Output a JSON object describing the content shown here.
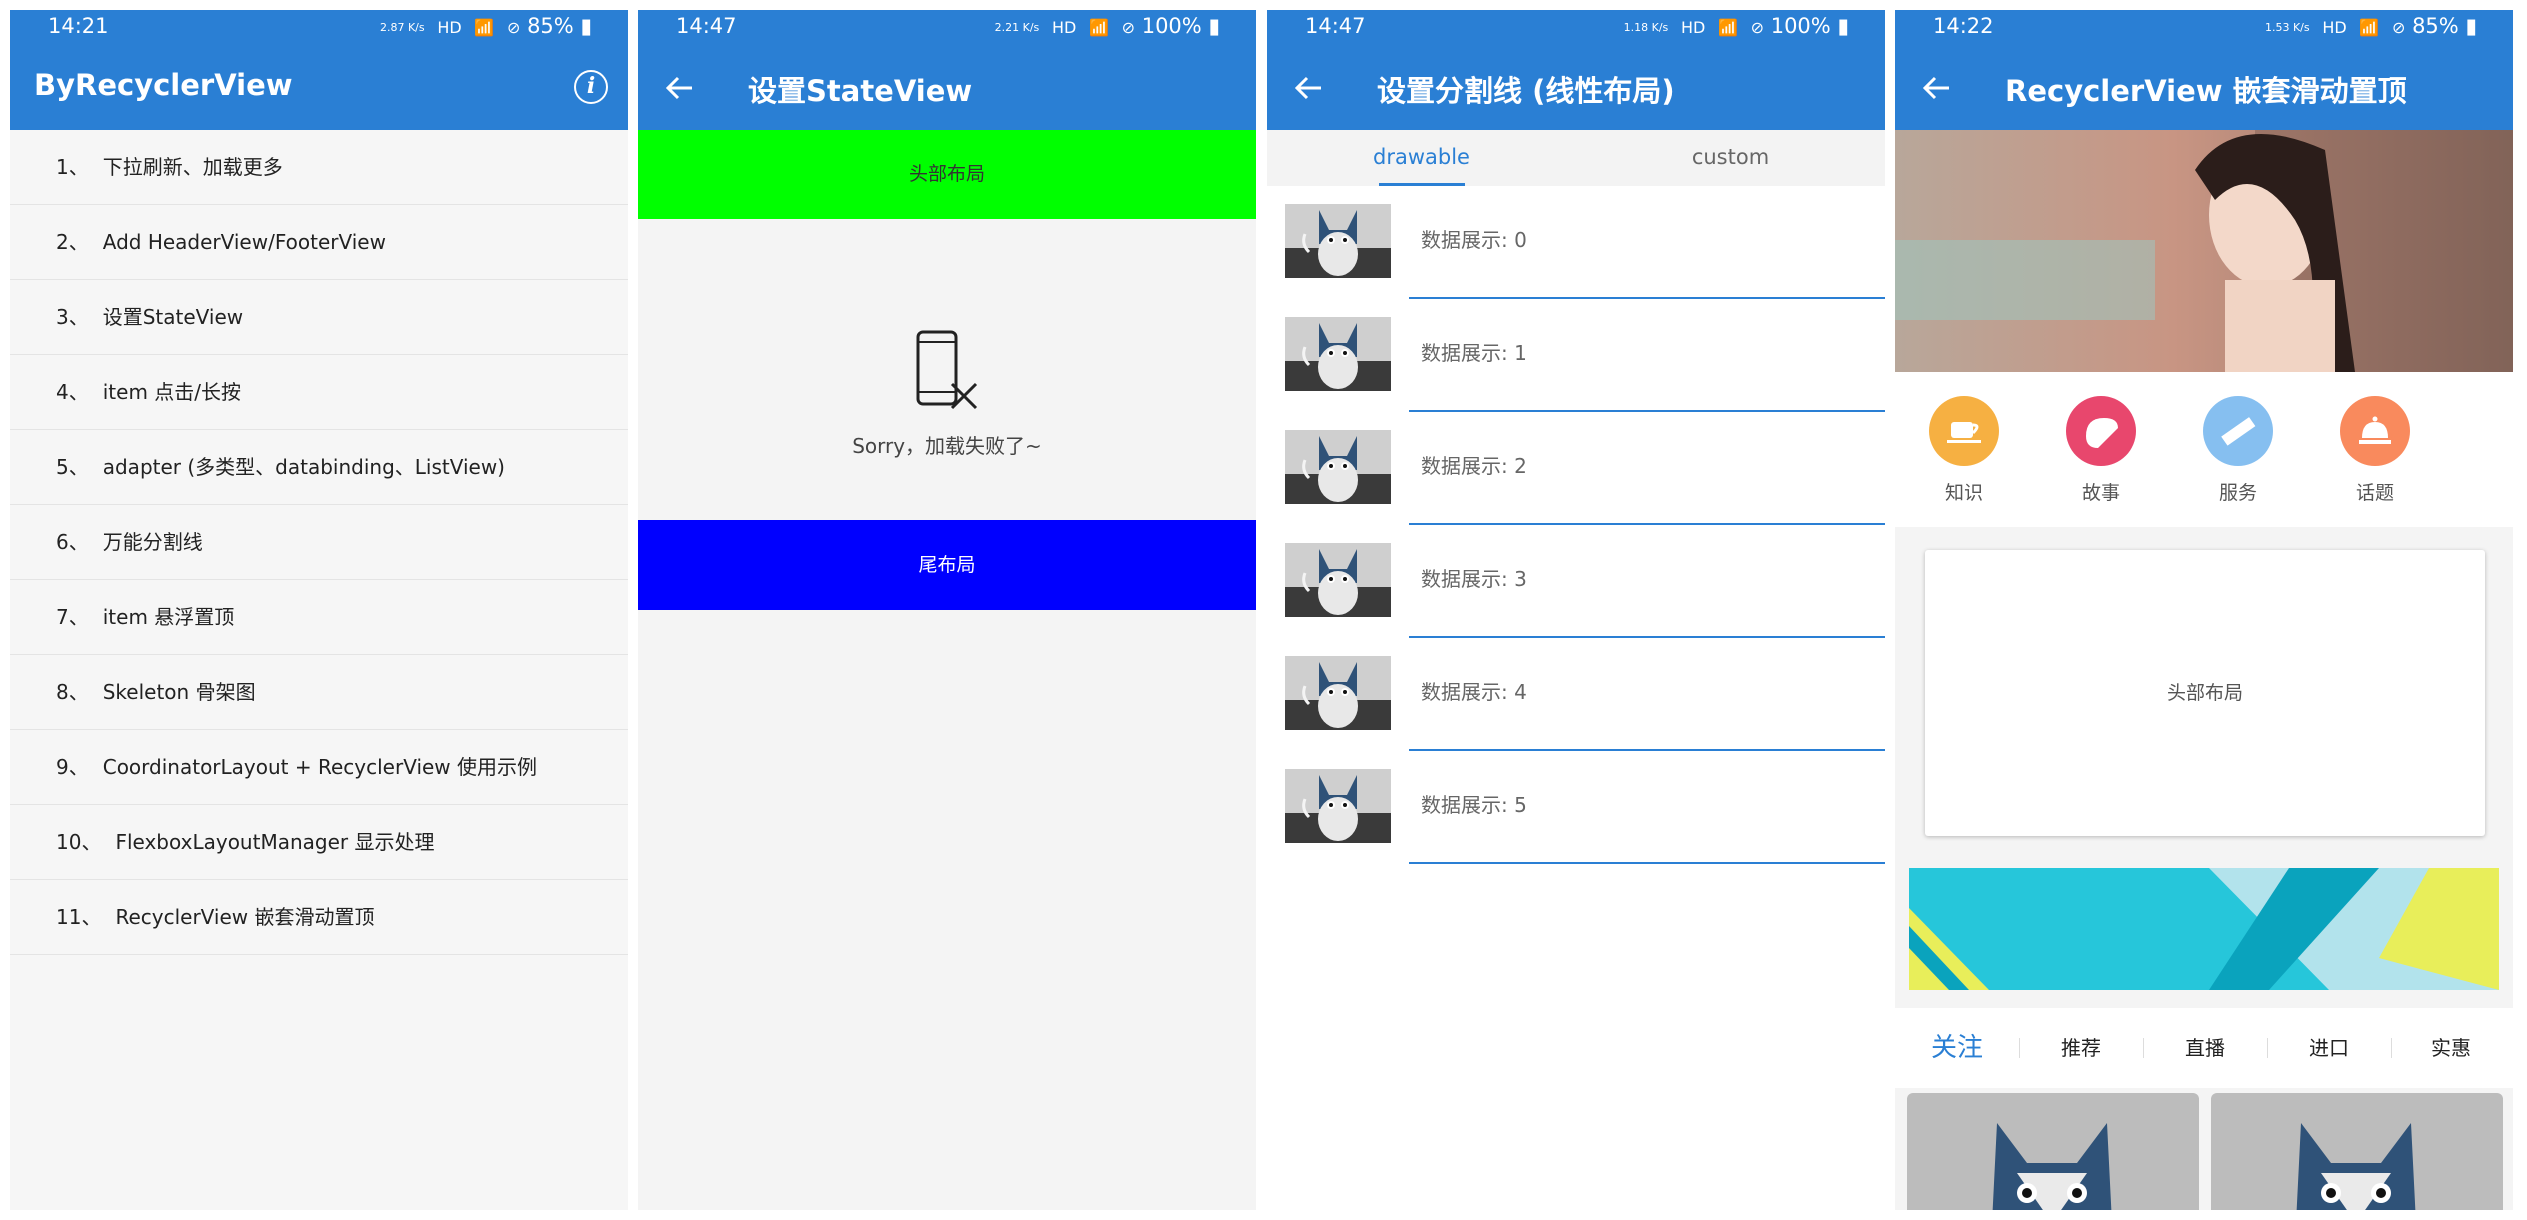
{
  "colors": {
    "primary": "#2a7fd4",
    "header_green": "#00ff00",
    "footer_blue": "#0000ff"
  },
  "panel1": {
    "status": {
      "time": "14:21",
      "speed": "2.87 K/s",
      "hd": "HD",
      "battery": "85%"
    },
    "title": "ByRecyclerView",
    "info_icon": "i",
    "items": [
      {
        "num": "1、",
        "label": "下拉刷新、加载更多"
      },
      {
        "num": "2、",
        "label": "Add HeaderView/FooterView"
      },
      {
        "num": "3、",
        "label": "设置StateView"
      },
      {
        "num": "4、",
        "label": "item 点击/长按"
      },
      {
        "num": "5、",
        "label": "adapter (多类型、databinding、ListView)"
      },
      {
        "num": "6、",
        "label": "万能分割线"
      },
      {
        "num": "7、",
        "label": "item 悬浮置顶"
      },
      {
        "num": "8、",
        "label": "Skeleton 骨架图"
      },
      {
        "num": "9、",
        "label": "CoordinatorLayout + RecyclerView 使用示例"
      },
      {
        "num": "10、",
        "label": "FlexboxLayoutManager 显示处理"
      },
      {
        "num": "11、",
        "label": "RecyclerView 嵌套滑动置顶"
      }
    ]
  },
  "panel2": {
    "status": {
      "time": "14:47",
      "speed": "2.21 K/s",
      "hd": "HD",
      "battery": "100%"
    },
    "title": "设置StateView",
    "header_label": "头部布局",
    "error_text": "Sorry，加载失败了~",
    "footer_label": "尾布局"
  },
  "panel3": {
    "status": {
      "time": "14:47",
      "speed": "1.18 K/s",
      "hd": "HD",
      "battery": "100%"
    },
    "title": "设置分割线 (线性布局)",
    "tabs": [
      "drawable",
      "custom"
    ],
    "rows": [
      "数据展示: 0",
      "数据展示: 1",
      "数据展示: 2",
      "数据展示: 3",
      "数据展示: 4",
      "数据展示: 5"
    ]
  },
  "panel4": {
    "status": {
      "time": "14:22",
      "speed": "1.53 K/s",
      "hd": "HD",
      "battery": "85%"
    },
    "title": "RecyclerView 嵌套滑动置顶",
    "categories": [
      {
        "label": "知识",
        "color": "#f6b042",
        "icon": "cup-icon"
      },
      {
        "label": "故事",
        "color": "#e8476d",
        "icon": "bread-icon"
      },
      {
        "label": "服务",
        "color": "#86bff0",
        "icon": "ruler-icon"
      },
      {
        "label": "话题",
        "color": "#f98a5d",
        "icon": "bell-icon"
      }
    ],
    "header_card_label": "头部布局",
    "tabs": [
      "关注",
      "推荐",
      "直播",
      "进口",
      "实惠"
    ]
  }
}
